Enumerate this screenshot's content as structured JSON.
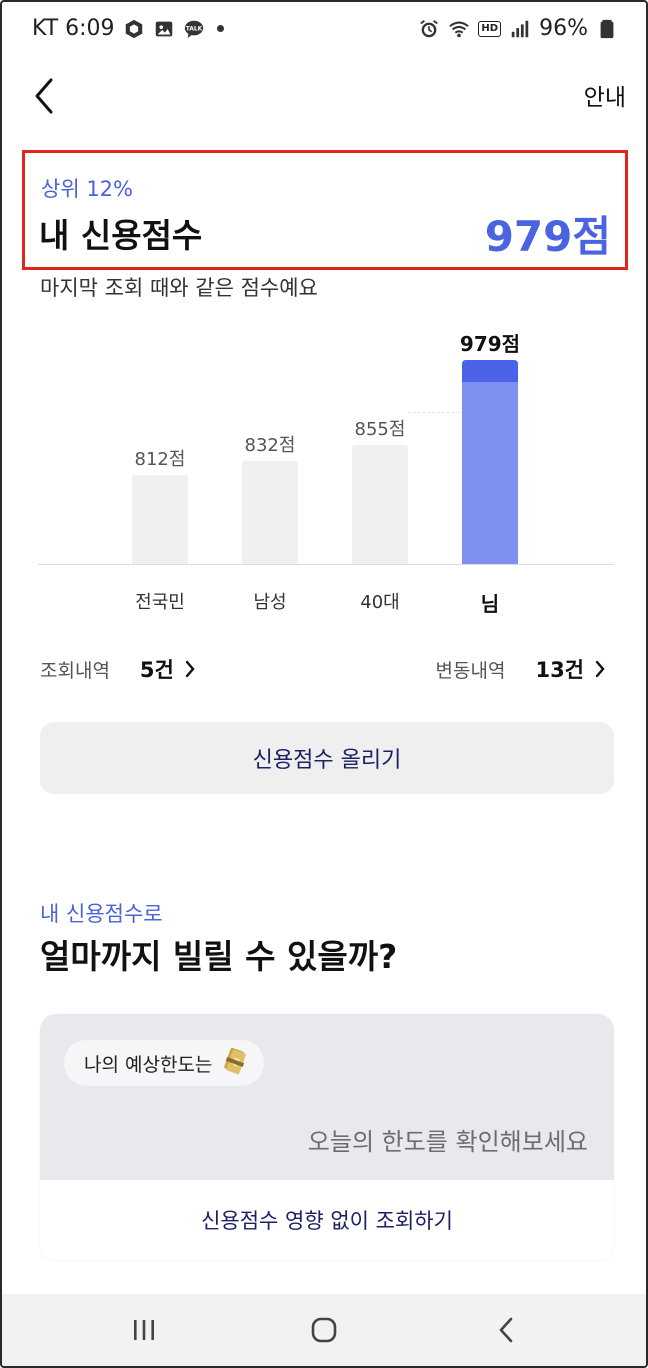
{
  "status_bar": {
    "carrier_time": "KT 6:09",
    "battery": "96%",
    "hd": "HD",
    "left_icons": [
      "app-box-icon",
      "image-icon",
      "talk-icon"
    ],
    "right_icons": [
      "alarm-icon",
      "wifi-icon",
      "hd-icon",
      "signal-icon",
      "battery-icon"
    ],
    "talk_text": "TALK"
  },
  "header": {
    "info_label": "안내"
  },
  "score": {
    "rank": "상위 12%",
    "title": "내 신용점수",
    "value": "979점",
    "note": "마지막 조회 때와 같은 점수예요",
    "highlight_color": "#e0261b",
    "accent_color": "#4a63e0"
  },
  "chart_data": {
    "type": "bar",
    "categories": [
      "전국민",
      "남성",
      "40대",
      "님"
    ],
    "values": [
      812,
      832,
      855,
      979
    ],
    "value_labels": [
      "812점",
      "832점",
      "855점",
      "979점"
    ],
    "highlight_index": 3,
    "ylim": [
      0,
      1000
    ]
  },
  "history": {
    "lookup_label": "조회내역",
    "lookup_count": "5건",
    "change_label": "변동내역",
    "change_count": "13건"
  },
  "raise_button": {
    "label": "신용점수 올리기"
  },
  "loan_section": {
    "eyebrow": "내 신용점수로",
    "title": "얼마까지 빌릴 수 있을까?",
    "chip_label": "나의 예상한도는",
    "message": "오늘의 한도를 확인해보세요",
    "action_label": "신용점수 영향 없이 조회하기"
  }
}
